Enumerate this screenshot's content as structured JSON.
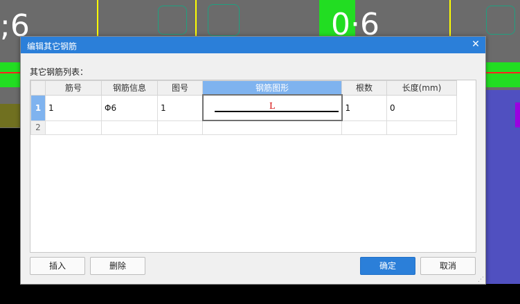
{
  "background": {
    "left_text": ";6",
    "right_text": "0·6"
  },
  "dialog": {
    "title": "编辑其它钢筋",
    "list_label": "其它钢筋列表：",
    "columns": [
      "筋号",
      "钢筋信息",
      "图号",
      "钢筋图形",
      "根数",
      "长度(mm)"
    ],
    "rows": [
      {
        "num": "1",
        "bar_no": "1",
        "info": "Φ6",
        "figure_no": "1",
        "shape_label": "L",
        "count": "1",
        "length": "0"
      },
      {
        "num": "2",
        "bar_no": "",
        "info": "",
        "figure_no": "",
        "shape_label": "",
        "count": "",
        "length": ""
      }
    ],
    "buttons": {
      "insert": "插入",
      "delete": "删除",
      "ok": "确定",
      "cancel": "取消"
    }
  },
  "colors": {
    "accent": "#2b7fd9",
    "selected_header": "#7fb3ef",
    "shape_label": "#d40000"
  }
}
